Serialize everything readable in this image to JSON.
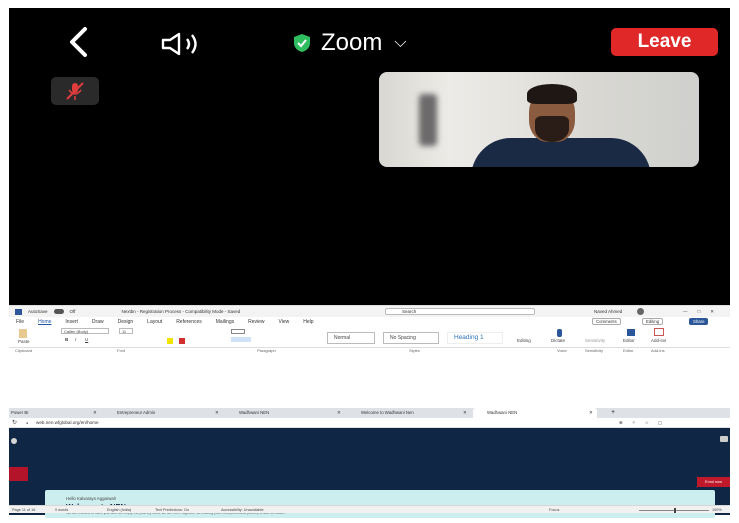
{
  "zoom": {
    "title": "Zoom",
    "leave_label": "Leave",
    "colors": {
      "leave": "#e02828",
      "shield": "#2fbe5f",
      "mute": "#e03c3c"
    },
    "icons": [
      "back-chevron-icon",
      "speaker-icon",
      "shield-check-icon",
      "chevron-down-icon",
      "mic-muted-icon"
    ]
  },
  "word": {
    "autosave_label": "AutoSave",
    "autosave_state": "Off",
    "doc_title": "Nextbn - Registration Process - Compatibility Mode - Saved",
    "search_placeholder": "Search",
    "user_name": "Naved Ahmed",
    "menu": [
      "File",
      "Home",
      "Insert",
      "Draw",
      "Design",
      "Layout",
      "References",
      "Mailings",
      "Review",
      "View",
      "Help"
    ],
    "active_menu": "Home",
    "right_buttons": {
      "comments": "Comments",
      "editing": "Editing",
      "share": "Share"
    },
    "font_name": "Calibri (Body)",
    "font_size": "11",
    "styles": [
      "Normal",
      "No Spacing",
      "Heading 1"
    ],
    "tools": [
      "Editing",
      "Dictate",
      "Sensitivity",
      "Editor",
      "Add-ins"
    ],
    "groups": [
      "Clipboard",
      "Font",
      "Paragraph",
      "Styles",
      "Voice",
      "Sensitivity",
      "Editor",
      "Add-ins"
    ],
    "paste_label": "Paste",
    "status": {
      "page": "Page 11 of 16",
      "words": "0 words",
      "language": "English (India)",
      "predictions": "Text Predictions: On",
      "accessibility": "Accessibility: Unavailable",
      "focus": "Focus",
      "zoom": "100%"
    },
    "colors": {
      "brand": "#2b579a"
    }
  },
  "browser": {
    "tabs": [
      "Power BI",
      "Entrepreneur Admin",
      "Wadhwani NEN",
      "Welcome to Wadhwani Nen",
      "Wadhwani NEN"
    ],
    "url": "web.nen.wfglobal.org/en/home",
    "page": {
      "greeting": "Hello Kalvarays Aggarwal!",
      "welcome": "Welcome to NEN",
      "description": "We are excited to have you with us. Enjoy the journey while we are here together, so making your entrepreneurial journey a little bit easier.",
      "button": "Enrol now"
    },
    "colors": {
      "page_bg": "#0f2744",
      "card": "#cdeeee",
      "accent": "#c0192b"
    }
  }
}
